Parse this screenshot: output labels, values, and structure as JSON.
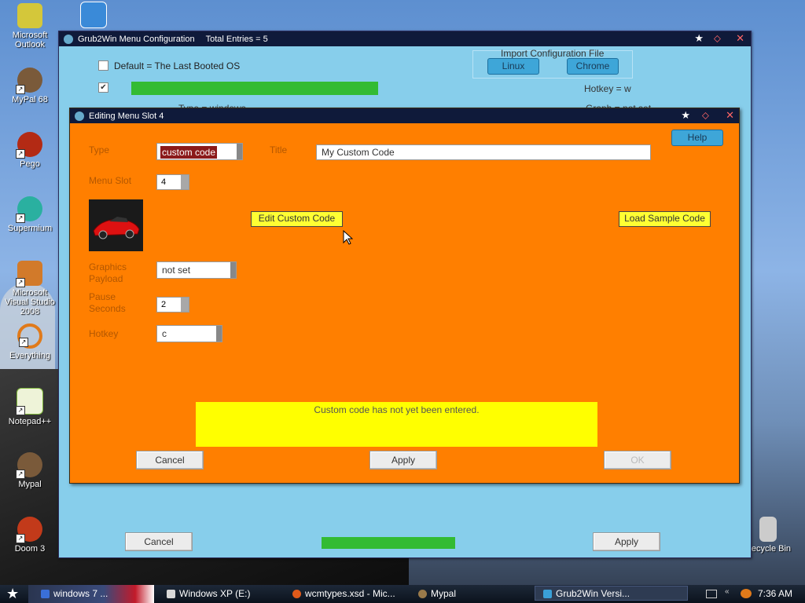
{
  "desktop_icons": [
    {
      "label": "Microsoft Outlook",
      "color": "#d4c73a"
    },
    {
      "label": "MyPal 68",
      "color": "#7a5a3a"
    },
    {
      "label": "Pego",
      "color": "#b32a14"
    },
    {
      "label": "Supermium",
      "color": "#2ab0a0"
    },
    {
      "label": "Microsoft Visual Studio 2008",
      "color": "#d27a2a"
    },
    {
      "label": "Everything",
      "color": "#e07a1a"
    },
    {
      "label": "Notepad++",
      "color": "#7fb83a"
    },
    {
      "label": "Mypal",
      "color": "#7a5a3a"
    },
    {
      "label": "Doom 3",
      "color": "#c23a1a"
    },
    {
      "label": "Recycle Bin",
      "color": "#cccccc"
    }
  ],
  "main_window": {
    "title": "Grub2Win Menu Configuration",
    "total_entries": "Total Entries = 5",
    "default_checkbox_label": "Default = The Last Booted OS",
    "import_label": "Import Configuration File",
    "import_linux": "Linux",
    "import_chrome": "Chrome",
    "hotkey_text": "Hotkey = w",
    "type_text": "Type = windows",
    "graph_text": "Graph = not set",
    "green_bar_text": "",
    "cancel": "Cancel",
    "apply": "Apply",
    "bottom_green_text": ""
  },
  "edit_dialog": {
    "title": "Editing Menu Slot 4",
    "type_label": "Type",
    "type_value": "custom code",
    "title_label": "Title",
    "title_value": "My Custom Code",
    "help": "Help",
    "menu_slot_label": "Menu Slot",
    "menu_slot_value": "4",
    "edit_custom_code": "Edit Custom Code",
    "load_sample_code": "Load Sample Code",
    "graphics_payload_label_1": "Graphics",
    "graphics_payload_label_2": "Payload",
    "graphics_payload_value": "not set",
    "pause_label_1": "Pause",
    "pause_label_2": "Seconds",
    "pause_value": "2",
    "hotkey_label": "Hotkey",
    "hotkey_value": "c",
    "message": "Custom code has not yet been entered.",
    "cancel": "Cancel",
    "apply": "Apply",
    "ok": "OK"
  },
  "taskbar": {
    "items": [
      {
        "label": "windows 7 ...",
        "color": "#3a6fd8"
      },
      {
        "label": "Windows XP (E:)",
        "color": "#d8d8d8"
      },
      {
        "label": "wcmtypes.xsd - Mic...",
        "color": "#e05a1a"
      },
      {
        "label": "Mypal",
        "color": "#9a7a4a"
      },
      {
        "label": "Grub2Win   Versi...",
        "color": "#3aa0d8"
      }
    ],
    "clock": "7:36 AM"
  },
  "colors": {
    "dialog_bg": "#ff7f00",
    "main_bg": "#87ceeb",
    "type_highlight": "#8b1a1a"
  }
}
